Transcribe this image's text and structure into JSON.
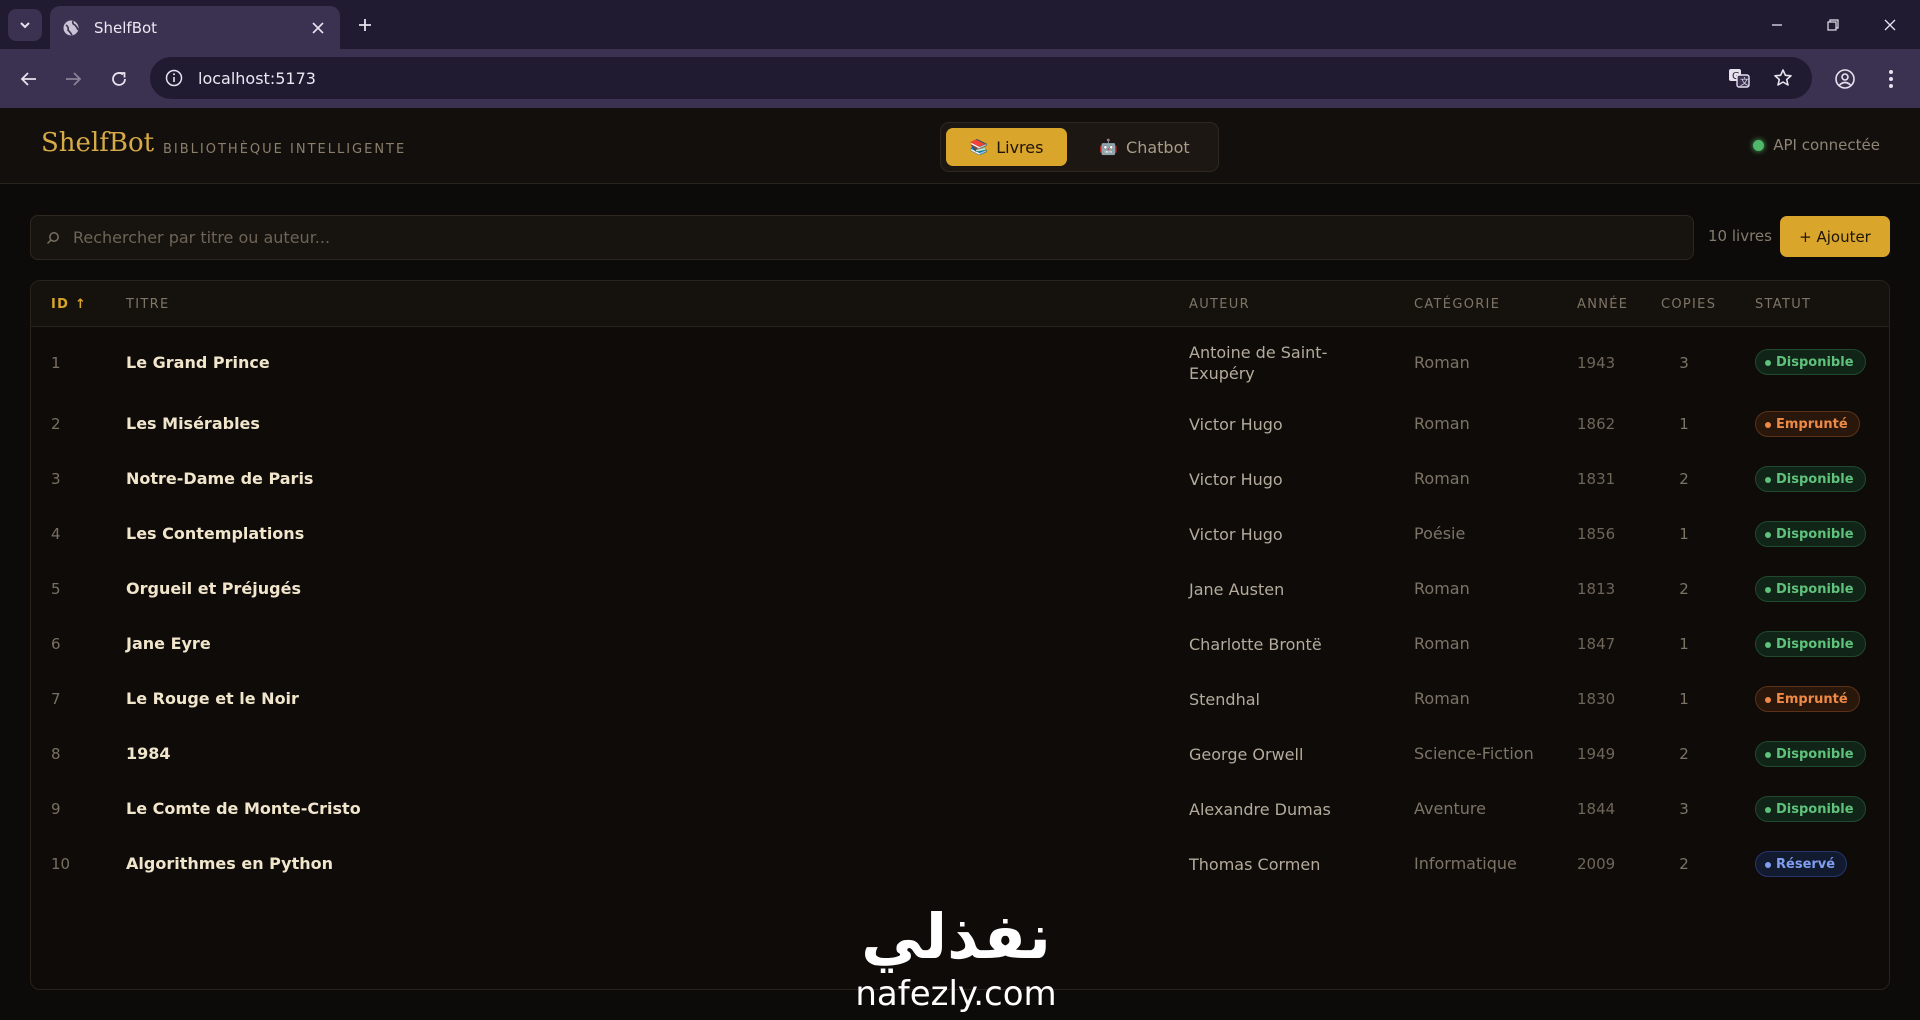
{
  "browser": {
    "tab_title": "ShelfBot",
    "url": "localhost:5173"
  },
  "app": {
    "brand": "ShelfBot",
    "tagline": "BIBLIOTHÈQUE INTELLIGENTE",
    "nav": {
      "books_emoji": "📚",
      "books_label": "Livres",
      "chatbot_emoji": "🤖",
      "chatbot_label": "Chatbot"
    },
    "api_status": "API connectée"
  },
  "search": {
    "placeholder": "Rechercher par titre ou auteur...",
    "count_label": "10 livres",
    "add_label": "+ Ajouter"
  },
  "table": {
    "headers": {
      "id": "ID ↑",
      "title": "TITRE",
      "author": "AUTEUR",
      "category": "CATÉGORIE",
      "year": "ANNÉE",
      "copies": "COPIES",
      "status": "STATUT"
    },
    "rows": [
      {
        "id": "1",
        "title": "Le Grand Prince",
        "author": "Antoine de Saint-Exupéry",
        "category": "Roman",
        "year": "1943",
        "copies": "3",
        "status": "Disponible"
      },
      {
        "id": "2",
        "title": "Les Misérables",
        "author": "Victor Hugo",
        "category": "Roman",
        "year": "1862",
        "copies": "1",
        "status": "Emprunté"
      },
      {
        "id": "3",
        "title": "Notre-Dame de Paris",
        "author": "Victor Hugo",
        "category": "Roman",
        "year": "1831",
        "copies": "2",
        "status": "Disponible"
      },
      {
        "id": "4",
        "title": "Les Contemplations",
        "author": "Victor Hugo",
        "category": "Poésie",
        "year": "1856",
        "copies": "1",
        "status": "Disponible"
      },
      {
        "id": "5",
        "title": "Orgueil et Préjugés",
        "author": "Jane Austen",
        "category": "Roman",
        "year": "1813",
        "copies": "2",
        "status": "Disponible"
      },
      {
        "id": "6",
        "title": "Jane Eyre",
        "author": "Charlotte Brontë",
        "category": "Roman",
        "year": "1847",
        "copies": "1",
        "status": "Disponible"
      },
      {
        "id": "7",
        "title": "Le Rouge et le Noir",
        "author": "Stendhal",
        "category": "Roman",
        "year": "1830",
        "copies": "1",
        "status": "Emprunté"
      },
      {
        "id": "8",
        "title": "1984",
        "author": "George Orwell",
        "category": "Science-Fiction",
        "year": "1949",
        "copies": "2",
        "status": "Disponible"
      },
      {
        "id": "9",
        "title": "Le Comte de Monte-Cristo",
        "author": "Alexandre Dumas",
        "category": "Aventure",
        "year": "1844",
        "copies": "3",
        "status": "Disponible"
      },
      {
        "id": "10",
        "title": "Algorithmes en Python",
        "author": "Thomas Cormen",
        "category": "Informatique",
        "year": "2009",
        "copies": "2",
        "status": "Réservé"
      }
    ]
  },
  "watermark": {
    "arabic": "نفذلي",
    "latin": "nafezly.com"
  },
  "colors": {
    "accent": "#d9a52b",
    "available": "#5fc27b",
    "borrowed": "#ee8a45",
    "reserved": "#7f9ef0"
  }
}
